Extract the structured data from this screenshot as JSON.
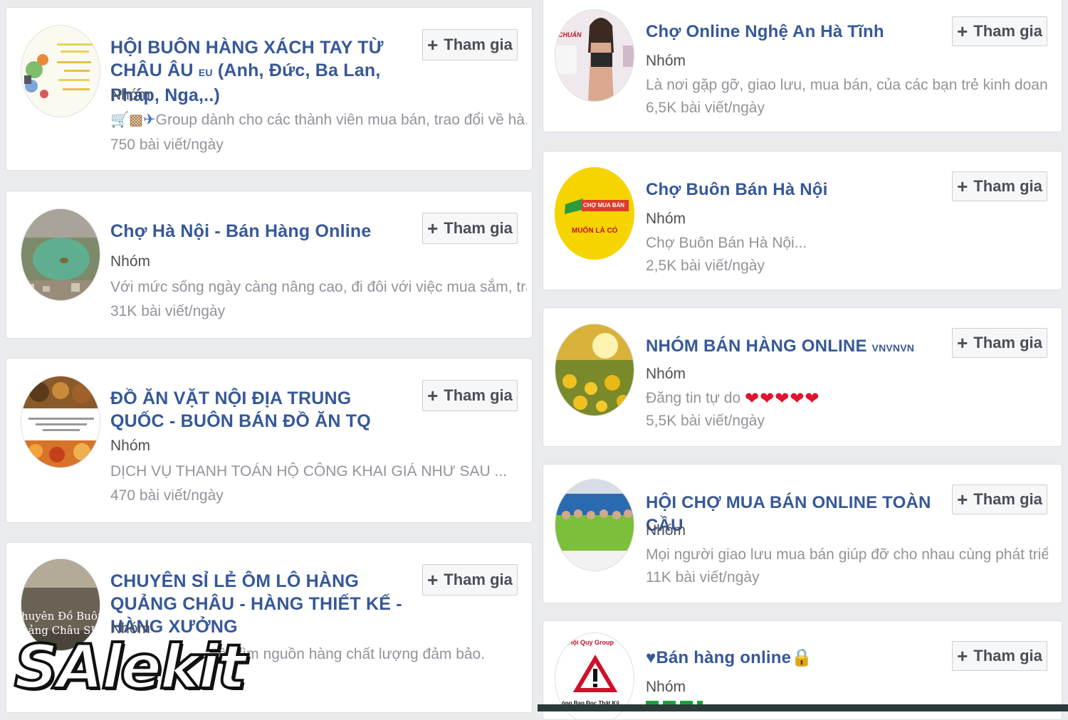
{
  "join_label": "Tham gia",
  "plus_glyph": "+",
  "left_groups": [
    {
      "title_main": "HỘI BUÔN HÀNG XÁCH TAY TỪ CHÂU ÂU ",
      "title_small": "EU",
      "title_tail": " (Anh, Đức, Ba Lan, Pháp, Nga,..)",
      "type": "Nhóm",
      "description": "Group dành cho các thành viên mua bán, trao đổi về hà...",
      "posts": "750 bài viết/ngày"
    },
    {
      "title_main": "Chợ Hà Nội - Bán Hàng Online",
      "type": "Nhóm",
      "description": "Với mức sống ngày càng nâng cao, đi đôi với việc mua sắm, trao đ...",
      "posts": "31K bài viết/ngày"
    },
    {
      "title_main": "ĐỒ ĂN VẶT NỘI ĐỊA TRUNG QUỐC - BUÔN BÁN ĐỒ ĂN TQ",
      "type": "Nhóm",
      "description": "DỊCH VỤ THANH TOÁN HỘ CÔNG KHAI GIÁ NHƯ SAU ...",
      "posts": "470 bài viết/ngày"
    },
    {
      "title_main": "CHUYÊN SỈ LẺ ÔM LÔ HÀNG QUẢNG CHÂU - HÀNG THIẾT KẾ - HÀNG XƯỞNG",
      "type": "Nhóm",
      "description": "...ệc tìm nguồn hàng chất lượng đảm bảo."
    }
  ],
  "right_groups": [
    {
      "title_main": "Chợ Online Nghệ An Hà Tĩnh",
      "type": "Nhóm",
      "description": "Là nơi gặp gỡ, giao lưu, mua bán, của các bạn trẻ kinh doanh onli...",
      "posts": "6,5K bài viết/ngày"
    },
    {
      "title_main": "Chợ Buôn Bán Hà Nội",
      "type": "Nhóm",
      "description": "Chợ Buôn Bán Hà Nội...",
      "posts": "2,5K bài viết/ngày"
    },
    {
      "title_main": "NHÓM BÁN HÀNG ONLINE ",
      "title_small": "VNVNVN",
      "type": "Nhóm",
      "description": "Đăng tin tự do ",
      "hearts": "❤❤❤❤❤",
      "posts": "5,5K bài viết/ngày"
    },
    {
      "title_main": "HỘI CHỢ MUA BÁN ONLINE TOÀN CẦU",
      "type": "Nhóm",
      "description": "Mọi người giao lưu mua bán giúp đỡ cho nhau cùng phát triển",
      "posts": "11K bài viết/ngày"
    },
    {
      "title_main": "♥Bán hàng online",
      "title_icon": "🔒",
      "type": "Nhóm"
    }
  ],
  "avatar_texts": {
    "cho_mua_ban": "CHỢ MUA BÁN",
    "muon_la_co": "MUỐN LÀ CÓ",
    "chuan": "CHUẨN",
    "quy_group": "Hội Quy Group",
    "long_ban": "Lòng Bạn Đọc Thật Kỹ",
    "quang_chau_1": "huyên Đồ Buôn",
    "quang_chau_2": "uảng Châu SLL"
  },
  "watermark": "SAlekit",
  "colors": {
    "link": "#365899",
    "background": "#e9ebee",
    "heart": "#e0142d"
  }
}
